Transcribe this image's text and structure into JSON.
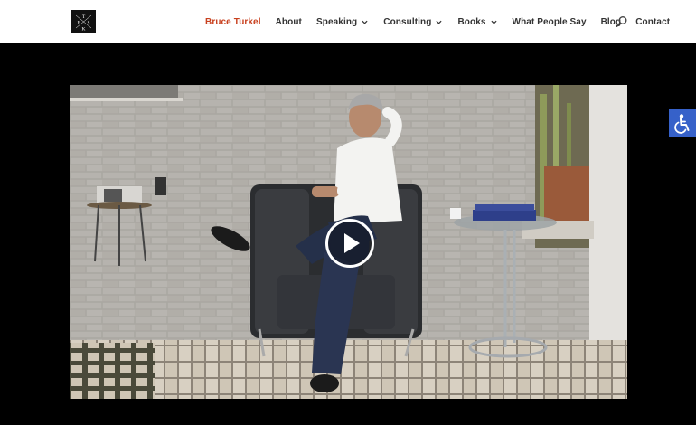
{
  "header": {
    "logo_icon": "tfk-monogram-logo",
    "nav": [
      {
        "label": "Bruce Turkel",
        "active": true,
        "has_dropdown": false
      },
      {
        "label": "About",
        "active": false,
        "has_dropdown": false
      },
      {
        "label": "Speaking",
        "active": false,
        "has_dropdown": true
      },
      {
        "label": "Consulting",
        "active": false,
        "has_dropdown": true
      },
      {
        "label": "Books",
        "active": false,
        "has_dropdown": true
      },
      {
        "label": "What People Say",
        "active": false,
        "has_dropdown": false
      },
      {
        "label": "Blog",
        "active": false,
        "has_dropdown": false
      },
      {
        "label": "Contact",
        "active": false,
        "has_dropdown": false
      }
    ],
    "search_icon": "search-icon"
  },
  "video": {
    "thumbnail_subject": "man seated in leather armchair by brick wall",
    "play_icon": "play-icon"
  },
  "accessibility": {
    "icon": "wheelchair-accessibility-icon"
  },
  "colors": {
    "accent": "#c8401e",
    "nav_text": "#333333",
    "header_bg": "#ffffff",
    "page_bg": "#000000",
    "a11y_bg": "#3661c9"
  }
}
